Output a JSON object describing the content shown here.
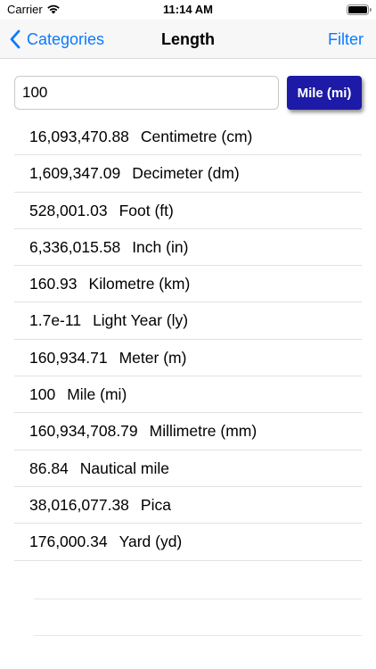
{
  "status_bar": {
    "carrier": "Carrier",
    "time": "11:14 AM"
  },
  "navbar": {
    "back_label": "Categories",
    "title": "Length",
    "filter_label": "Filter"
  },
  "converter": {
    "input_value": "100",
    "unit_button_label": "Mile (mi)",
    "accent_color": "#1c1aa6"
  },
  "results": [
    {
      "value": "16,093,470.88",
      "unit": "Centimetre (cm)"
    },
    {
      "value": "1,609,347.09",
      "unit": "Decimeter (dm)"
    },
    {
      "value": "528,001.03",
      "unit": "Foot (ft)"
    },
    {
      "value": "6,336,015.58",
      "unit": "Inch (in)"
    },
    {
      "value": "160.93",
      "unit": "Kilometre (km)"
    },
    {
      "value": "1.7e-11",
      "unit": "Light Year (ly)"
    },
    {
      "value": "160,934.71",
      "unit": "Meter (m)"
    },
    {
      "value": "100",
      "unit": "Mile (mi)"
    },
    {
      "value": "160,934,708.79",
      "unit": "Millimetre (mm)"
    },
    {
      "value": "86.84",
      "unit": "Nautical mile"
    },
    {
      "value": "38,016,077.38",
      "unit": "Pica"
    },
    {
      "value": "176,000.34",
      "unit": "Yard (yd)"
    }
  ]
}
